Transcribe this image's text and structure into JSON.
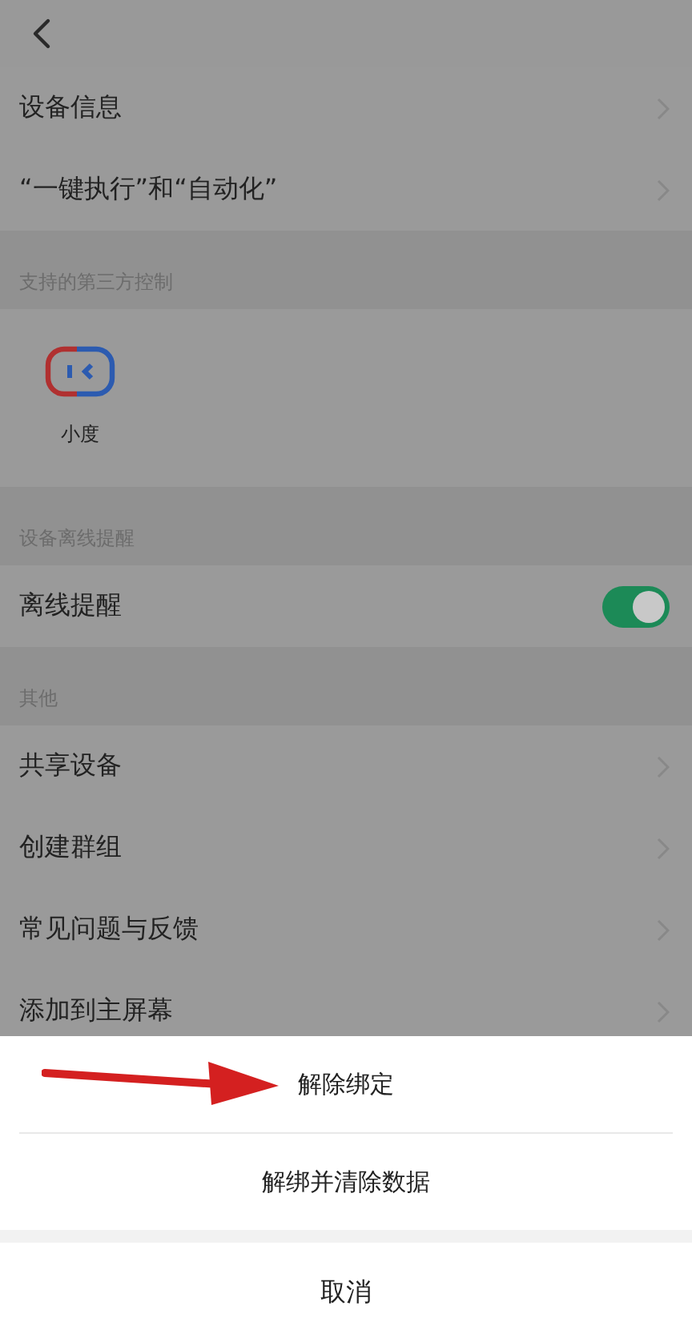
{
  "sections": [
    {
      "kind": "rows",
      "rows": [
        {
          "label": "设备信息",
          "kind": "link"
        },
        {
          "label": "“一键执行”和“自动化”",
          "kind": "link"
        }
      ]
    },
    {
      "kind": "apps",
      "header": "支持的第三方控制",
      "items": [
        {
          "label": "小度"
        }
      ]
    },
    {
      "kind": "rows",
      "header": "设备离线提醒",
      "rows": [
        {
          "label": "离线提醒",
          "kind": "toggle",
          "on": true
        }
      ]
    },
    {
      "kind": "rows",
      "header": "其他",
      "rows": [
        {
          "label": "共享设备",
          "kind": "link"
        },
        {
          "label": "创建群组",
          "kind": "link"
        },
        {
          "label": "常见问题与反馈",
          "kind": "link"
        },
        {
          "label": "添加到主屏幕",
          "kind": "link"
        }
      ]
    }
  ],
  "sheet": {
    "actions": [
      {
        "label": "解除绑定"
      },
      {
        "label": "解绑并清除数据"
      }
    ],
    "cancel": "取消"
  }
}
